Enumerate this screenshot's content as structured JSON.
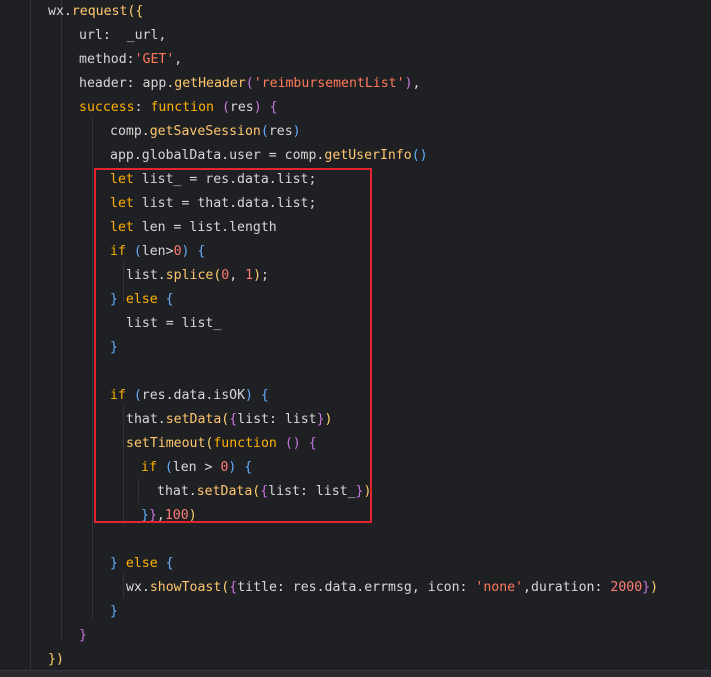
{
  "code": {
    "lines": [
      "wx.request({",
      "url:  _url,",
      "method:'GET',",
      "header: app.getHeader('reimbursementList'),",
      "success: function (res) {",
      "comp.getSaveSession(res)",
      "app.globalData.user = comp.getUserInfo()",
      "let list_ = res.data.list;",
      "let list = that.data.list;",
      "let len = list.length",
      "if (len>0) {",
      "list.splice(0, 1);",
      "} else {",
      "list = list_",
      "}",
      "",
      "if (res.data.isOK) {",
      "that.setData({list: list})",
      "setTimeout(function () {",
      "if (len > 0) {",
      "that.setData({list: list_})",
      "}},100)",
      "",
      "} else {",
      "wx.showToast({title: res.data.errmsg, icon: 'none',duration: 2000})",
      "}",
      "}",
      "})"
    ]
  },
  "colors": {
    "background": "#1f2024",
    "keyword": "#ffb000",
    "function": "#ffc66d",
    "string": "#ff7a59",
    "number": "#ff7b72",
    "highlight_border": "#e3252f"
  }
}
